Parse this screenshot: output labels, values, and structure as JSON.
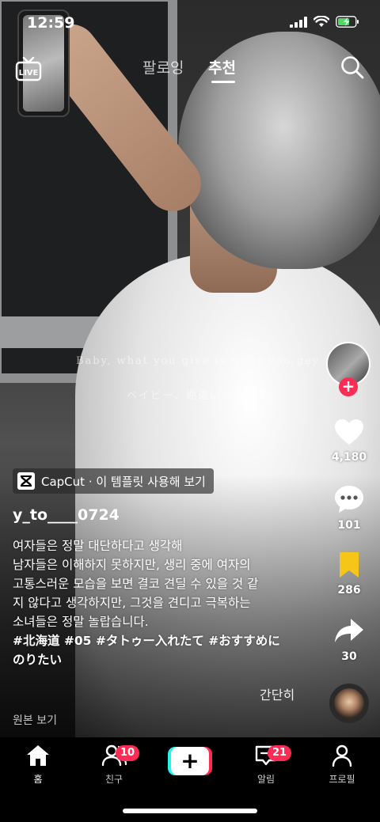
{
  "status_bar": {
    "time": "12:59"
  },
  "top_nav": {
    "live_label": "LIVE",
    "tab_following": "팔로잉",
    "tab_for_you": "추천"
  },
  "video": {
    "overlay_text_line1": "Baby, what you give is what you gey .",
    "overlay_text_line2": "ベイビー、勘違いしないで"
  },
  "rail": {
    "likes": "4,180",
    "comments": "101",
    "saves": "286",
    "shares": "30"
  },
  "post": {
    "capcut_label": "CapCut · 이 템플릿 사용해 보기",
    "username": "y_to____0724",
    "caption_lines": [
      "여자들은 정말 대단하다고 생각해",
      "남자들은 이해하지 못하지만, 생리 중에 여자의",
      "고통스러운 모습을 보면 결코 견딜 수 있을 것 같",
      "지 않다고 생각하지만, 그것을 견디고 극복하는",
      "소녀들은 정말 놀랍습니다.",
      " #北海道 #05 #タトゥー入れたて #おすすめに",
      "のりたい"
    ],
    "less_label": "간단히",
    "original_label": "원본 보기"
  },
  "tab_bar": {
    "home": "홈",
    "friends": "친구",
    "friends_badge": "10",
    "inbox": "알림",
    "inbox_badge": "21",
    "profile": "프로필",
    "create_symbol": "+"
  },
  "colors": {
    "accent": "#fe2c55",
    "save_yellow": "#f5c518",
    "cyan": "#25f4ee"
  }
}
